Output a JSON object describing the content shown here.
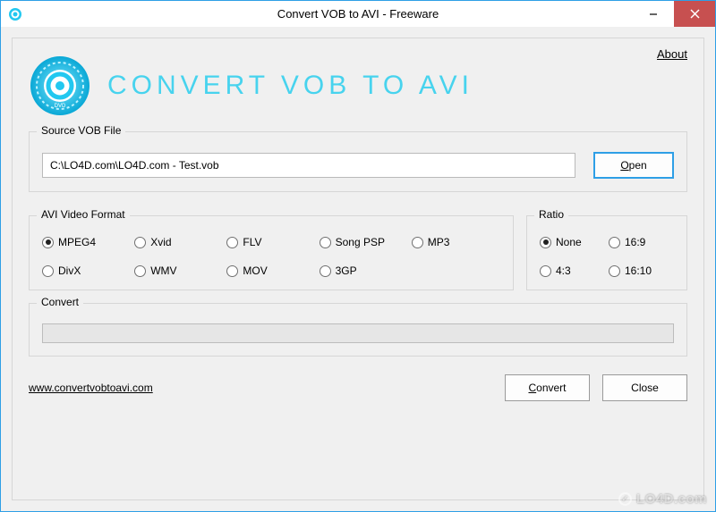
{
  "window": {
    "title": "Convert VOB to AVI - Freeware"
  },
  "header": {
    "about": "About",
    "app_title": "Convert VOB to AVI"
  },
  "source": {
    "legend": "Source VOB File",
    "path": "C:\\LO4D.com\\LO4D.com - Test.vob",
    "open_btn_prefix": "O",
    "open_btn_rest": "pen"
  },
  "format": {
    "legend": "AVI Video Format",
    "options": [
      "MPEG4",
      "Xvid",
      "FLV",
      "Song PSP",
      "MP3",
      "DivX",
      "WMV",
      "MOV",
      "3GP"
    ],
    "selected": "MPEG4"
  },
  "ratio": {
    "legend": "Ratio",
    "options": [
      "None",
      "16:9",
      "4:3",
      "16:10"
    ],
    "selected": "None"
  },
  "convert": {
    "legend": "Convert"
  },
  "footer": {
    "website": "www.convertvobtoavi.com",
    "convert_btn_prefix": "C",
    "convert_btn_rest": "onvert",
    "close_btn": "Close"
  },
  "watermark": "LO4D.com"
}
